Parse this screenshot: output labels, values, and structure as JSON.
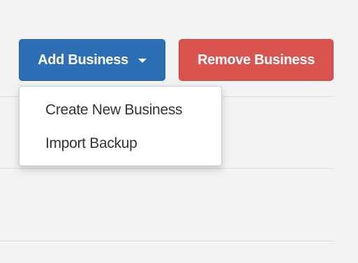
{
  "toolbar": {
    "add_business_label": "Add Business",
    "remove_business_label": "Remove Business"
  },
  "dropdown": {
    "items": [
      {
        "label": "Create New Business"
      },
      {
        "label": "Import Backup"
      }
    ]
  },
  "icons": {
    "add_business_caret": "caret-down-icon"
  },
  "colors": {
    "primary": "#2d6fb5",
    "danger": "#d9534f"
  }
}
